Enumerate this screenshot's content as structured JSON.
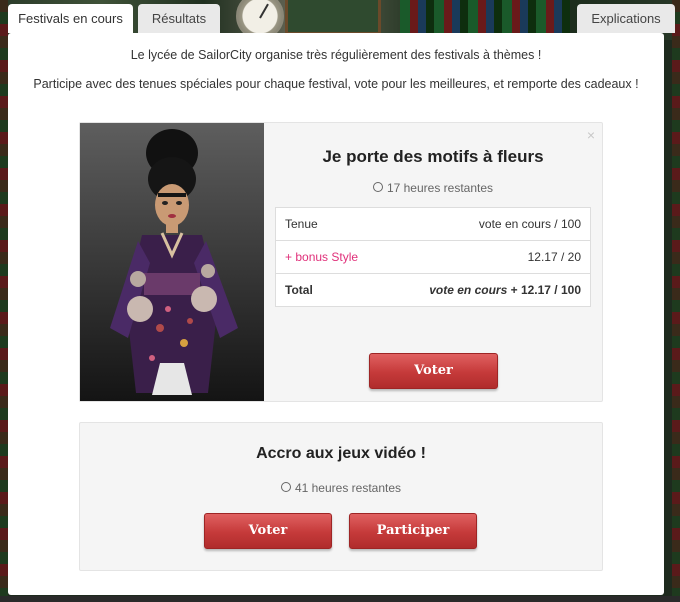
{
  "tabs": {
    "active": "Festivals en cours",
    "results": "Résultats",
    "explanations": "Explications"
  },
  "intro": {
    "line1": "Le lycée de SailorCity organise très régulièrement des festivals à thèmes !",
    "line2": "Participe avec des tenues spéciales pour chaque festival, vote pour les meilleures, et remporte des cadeaux !"
  },
  "festival1": {
    "close": "×",
    "title": "Je porte des motifs à fleurs",
    "time_left": "17 heures restantes",
    "rows": [
      {
        "label": "Tenue",
        "value": "vote en cours / 100"
      },
      {
        "label": "+ bonus Style",
        "value": "12.17 / 20"
      }
    ],
    "total_label": "Total",
    "total_italic": "vote en cours",
    "total_rest": " + 12.17 / 100",
    "vote_button": "Voter"
  },
  "festival2": {
    "title": "Accro aux jeux vidéo !",
    "time_left": "41 heures restantes",
    "vote_button": "Voter",
    "participate_button": "Participer"
  },
  "colors": {
    "button_red": "#c53a3a",
    "bonus_pink": "#e0307a"
  }
}
